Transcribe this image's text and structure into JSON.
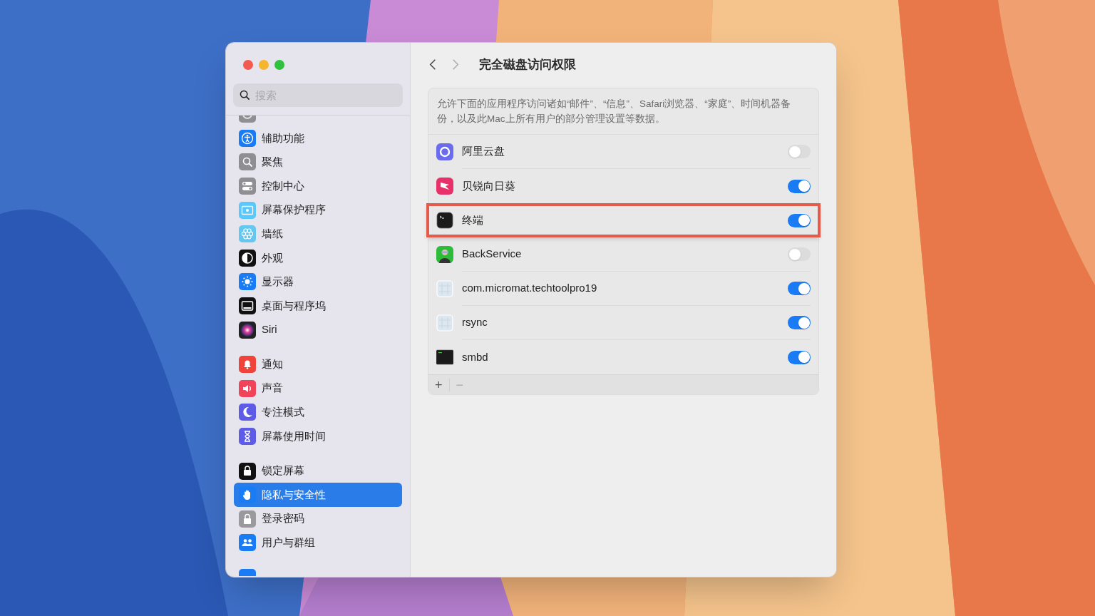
{
  "sidebar": {
    "search": {
      "placeholder": "搜索"
    },
    "groups": [
      [
        {
          "label": "辅助功能",
          "selected": false
        },
        {
          "label": "聚焦",
          "selected": false
        },
        {
          "label": "控制中心",
          "selected": false
        },
        {
          "label": "屏幕保护程序",
          "selected": false
        },
        {
          "label": "墙纸",
          "selected": false
        },
        {
          "label": "外观",
          "selected": false
        },
        {
          "label": "显示器",
          "selected": false
        },
        {
          "label": "桌面与程序坞",
          "selected": false
        },
        {
          "label": "Siri",
          "selected": false
        }
      ],
      [
        {
          "label": "通知",
          "selected": false
        },
        {
          "label": "声音",
          "selected": false
        },
        {
          "label": "专注模式",
          "selected": false
        },
        {
          "label": "屏幕使用时间",
          "selected": false
        }
      ],
      [
        {
          "label": "锁定屏幕",
          "selected": false
        },
        {
          "label": "隐私与安全性",
          "selected": true
        },
        {
          "label": "登录密码",
          "selected": false
        },
        {
          "label": "用户与群组",
          "selected": false
        }
      ]
    ]
  },
  "toolbar": {
    "title": "完全磁盘访问权限"
  },
  "description": "允许下面的应用程序访问诸如“邮件”、“信息”、Safari浏览器、“家庭”、时间机器备份，以及此Mac上所有用户的部分管理设置等数据。",
  "apps": [
    {
      "name": "阿里云盘",
      "on": false,
      "highlighted": false
    },
    {
      "name": "贝锐向日葵",
      "on": true,
      "highlighted": false
    },
    {
      "name": "终端",
      "on": true,
      "highlighted": true
    },
    {
      "name": "BackService",
      "on": false,
      "highlighted": false
    },
    {
      "name": "com.micromat.techtoolpro19",
      "on": true,
      "highlighted": false
    },
    {
      "name": "rsync",
      "on": true,
      "highlighted": false
    },
    {
      "name": "smbd",
      "on": true,
      "highlighted": false
    }
  ],
  "footer_buttons": [
    "+",
    "−"
  ]
}
